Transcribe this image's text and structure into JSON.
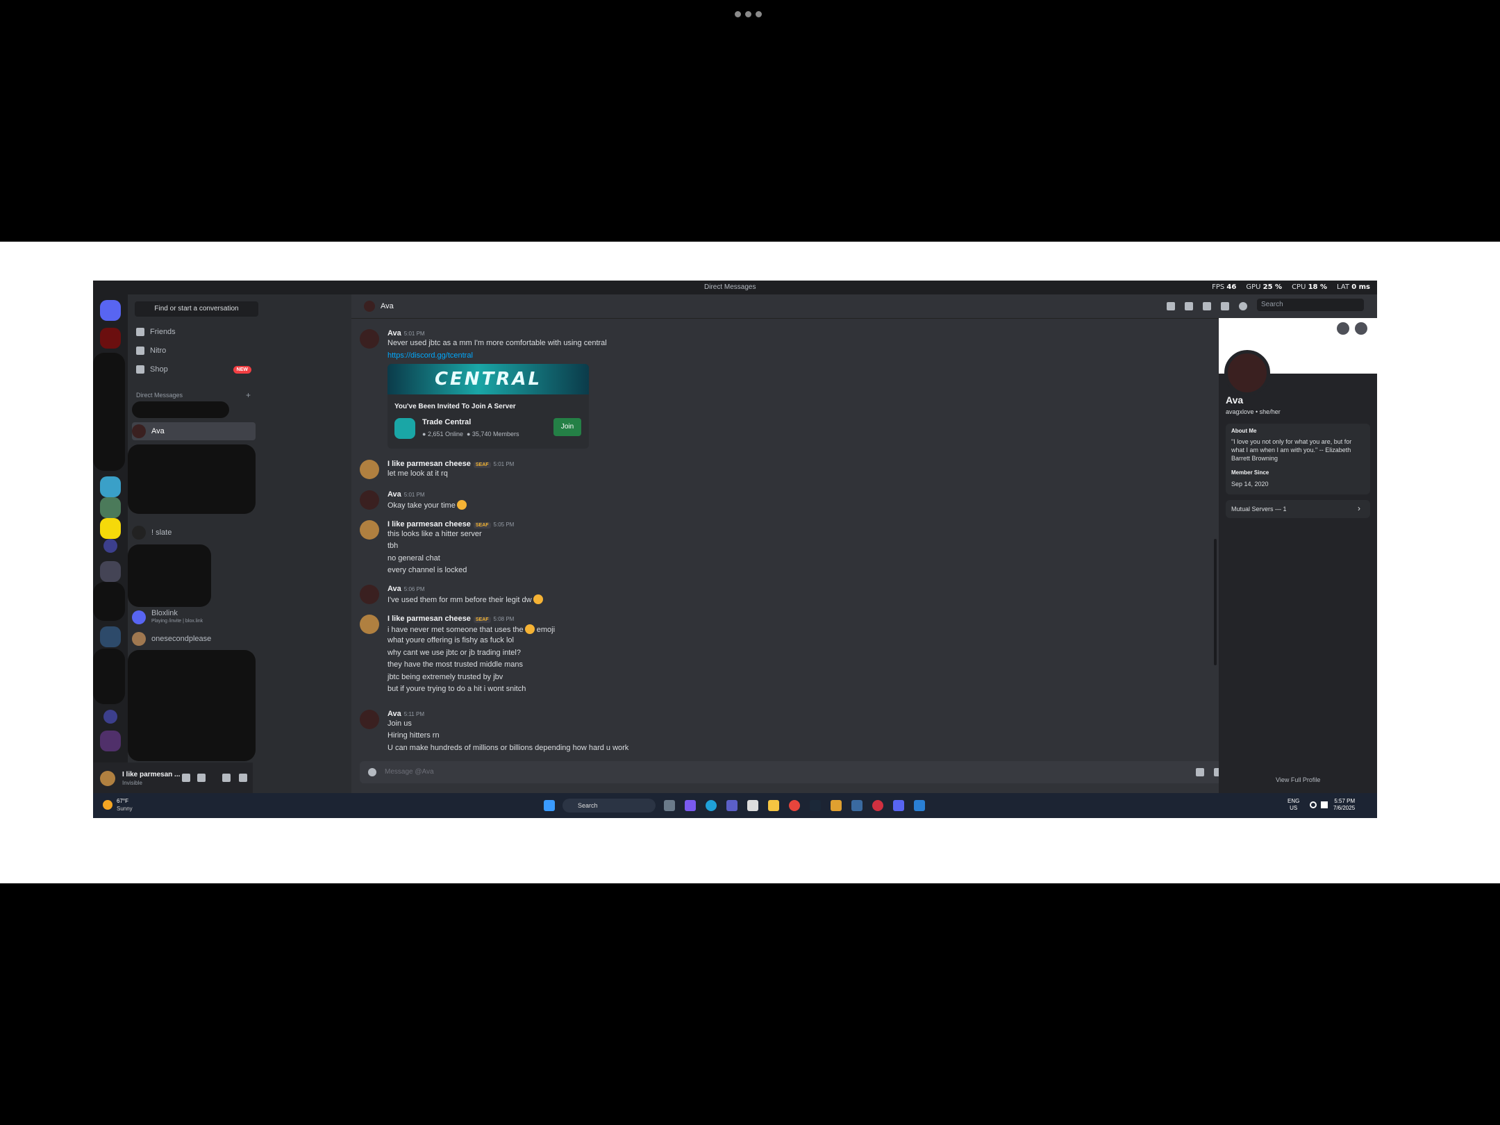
{
  "window": {
    "title": "Direct Messages"
  },
  "overlay": {
    "fps_label": "FPS",
    "fps_value": "46",
    "gpu_label": "GPU",
    "gpu_value": "25 %",
    "cpu_label": "CPU",
    "cpu_value": "18 %",
    "lat_label": "LAT",
    "lat_value": "0 ms"
  },
  "sidebar": {
    "find_placeholder": "Find or start a conversation",
    "nav": [
      {
        "label": "Friends"
      },
      {
        "label": "Nitro"
      },
      {
        "label": "Shop",
        "badge": "NEW"
      }
    ],
    "dm_header": "Direct Messages",
    "dms": [
      {
        "name": "Ava"
      },
      {
        "name": "! slate"
      },
      {
        "name": "Bloxlink",
        "status": "Playing /invite | blox.link"
      },
      {
        "name": "onesecondplease"
      }
    ]
  },
  "user": {
    "name": "I like parmesan ...",
    "status": "Invisible"
  },
  "header": {
    "title": "Ava",
    "search_placeholder": "Search"
  },
  "messages": [
    {
      "author": "Ava",
      "time": "5:01 PM",
      "lines": [
        "Never used jbtc as a mm I'm more comfortable with using central"
      ],
      "link": "https://discord.gg/tcentral"
    },
    {
      "author": "I like parmesan cheese",
      "tag": "SEAF",
      "time": "5:01 PM",
      "lines": [
        "let me look at it rq"
      ]
    },
    {
      "author": "Ava",
      "time": "5:01 PM",
      "lines": [
        "Okay take your time"
      ]
    },
    {
      "author": "I like parmesan cheese",
      "tag": "SEAF",
      "time": "5:05 PM",
      "lines": [
        "this looks like a hitter server",
        "tbh",
        "no general chat",
        "every channel is locked"
      ]
    },
    {
      "author": "Ava",
      "time": "5:06 PM",
      "lines": [
        "I've used them for mm before their legit dw"
      ]
    },
    {
      "author": "I like parmesan cheese",
      "tag": "SEAF",
      "time": "5:08 PM",
      "lines": [
        "i have never met someone that uses the",
        "what youre offering is fishy as fuck lol",
        "why cant we use jbtc or jb trading intel?",
        "they have the most trusted middle mans",
        "jbtc being extremely trusted by jbv",
        "but if youre trying to do a hit i wont snitch"
      ],
      "emoji_word": "emoji"
    },
    {
      "author": "Ava",
      "time": "5:11 PM",
      "lines": [
        "Join us",
        "Hiring hitters rn",
        "U can make hundreds of millions or billions depending how hard u work"
      ]
    }
  ],
  "invite": {
    "banner_text": "CENTRAL",
    "heading": "You've Been Invited To Join A Server",
    "server": "Trade Central",
    "online": "2,651 Online",
    "members": "35,740 Members",
    "join": "Join"
  },
  "composer": {
    "placeholder": "Message @Ava"
  },
  "profile": {
    "name": "Ava",
    "handle": "avagxlove • she/her",
    "about_title": "About Me",
    "about": "\"I love you not only for what you are, but for what I am when I am with you.\" -- Elizabeth Barrett Browning",
    "member_since_title": "Member Since",
    "member_since": "Sep 14, 2020",
    "mutual": "Mutual Servers — 1",
    "view_full": "View Full Profile"
  },
  "taskbar": {
    "weather_temp": "67°F",
    "weather_desc": "Sunny",
    "search": "Search",
    "lang": "ENG",
    "region": "US",
    "time": "5:57 PM",
    "date": "7/6/2025"
  },
  "colors": {
    "accent": "#5865f2",
    "join": "#248046",
    "link": "#00a8fc",
    "badge_new": "#f23f43"
  }
}
